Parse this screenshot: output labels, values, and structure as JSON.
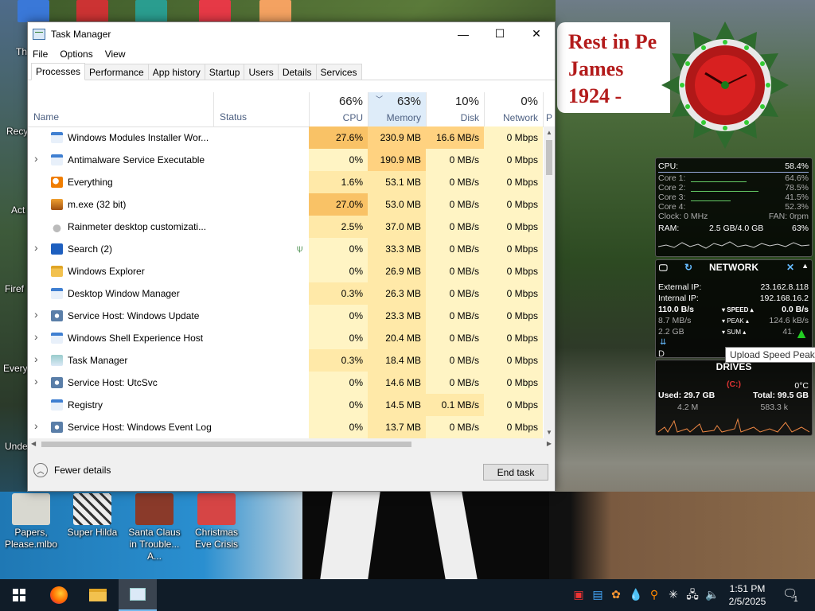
{
  "window": {
    "title": "Task Manager",
    "minimize_glyph": "—",
    "maximize_glyph": "☐",
    "close_glyph": "✕"
  },
  "menu": [
    "File",
    "Options",
    "View"
  ],
  "tabs": [
    "Processes",
    "Performance",
    "App history",
    "Startup",
    "Users",
    "Details",
    "Services"
  ],
  "active_tab": "Processes",
  "columns": {
    "name": "Name",
    "status": "Status",
    "cpu": {
      "pct": "66%",
      "label": "CPU"
    },
    "memory": {
      "pct": "63%",
      "label": "Memory"
    },
    "disk": {
      "pct": "10%",
      "label": "Disk"
    },
    "network": {
      "pct": "0%",
      "label": "Network"
    },
    "power_partial": "P"
  },
  "processes": [
    {
      "name": "Windows Modules Installer Wor...",
      "expandable": false,
      "icon": "windows-app-icon",
      "cpu": "27.6%",
      "memory": "230.9 MB",
      "disk": "16.6 MB/s",
      "network": "0 Mbps"
    },
    {
      "name": "Antimalware Service Executable",
      "expandable": true,
      "icon": "windows-app-icon",
      "cpu": "0%",
      "memory": "190.9 MB",
      "disk": "0 MB/s",
      "network": "0 Mbps"
    },
    {
      "name": "Everything",
      "expandable": false,
      "icon": "magnifier-orange-icon",
      "cpu": "1.6%",
      "memory": "53.1 MB",
      "disk": "0 MB/s",
      "network": "0 Mbps"
    },
    {
      "name": "m.exe (32 bit)",
      "expandable": false,
      "icon": "mascot-icon",
      "cpu": "27.0%",
      "memory": "53.0 MB",
      "disk": "0 MB/s",
      "network": "0 Mbps"
    },
    {
      "name": "Rainmeter desktop customizati...",
      "expandable": false,
      "icon": "rainmeter-drop-icon",
      "cpu": "2.5%",
      "memory": "37.0 MB",
      "disk": "0 MB/s",
      "network": "0 Mbps"
    },
    {
      "name": "Search (2)",
      "expandable": true,
      "icon": "search-icon",
      "cpu": "0%",
      "memory": "33.3 MB",
      "disk": "0 MB/s",
      "network": "0 Mbps",
      "suspended_leaf": true
    },
    {
      "name": "Windows Explorer",
      "expandable": false,
      "icon": "folder-icon",
      "cpu": "0%",
      "memory": "26.9 MB",
      "disk": "0 MB/s",
      "network": "0 Mbps"
    },
    {
      "name": "Desktop Window Manager",
      "expandable": false,
      "icon": "windows-app-icon",
      "cpu": "0.3%",
      "memory": "26.3 MB",
      "disk": "0 MB/s",
      "network": "0 Mbps"
    },
    {
      "name": "Service Host: Windows Update",
      "expandable": true,
      "icon": "gear-icon",
      "cpu": "0%",
      "memory": "23.3 MB",
      "disk": "0 MB/s",
      "network": "0 Mbps"
    },
    {
      "name": "Windows Shell Experience Host",
      "expandable": true,
      "icon": "windows-app-icon",
      "cpu": "0%",
      "memory": "20.4 MB",
      "disk": "0 MB/s",
      "network": "0 Mbps"
    },
    {
      "name": "Task Manager",
      "expandable": true,
      "icon": "task-manager-icon",
      "cpu": "0.3%",
      "memory": "18.4 MB",
      "disk": "0 MB/s",
      "network": "0 Mbps"
    },
    {
      "name": "Service Host: UtcSvc",
      "expandable": true,
      "icon": "gear-icon",
      "cpu": "0%",
      "memory": "14.6 MB",
      "disk": "0 MB/s",
      "network": "0 Mbps"
    },
    {
      "name": "Registry",
      "expandable": false,
      "icon": "windows-app-icon",
      "cpu": "0%",
      "memory": "14.5 MB",
      "disk": "0.1 MB/s",
      "network": "0 Mbps"
    },
    {
      "name": "Service Host: Windows Event Log",
      "expandable": true,
      "icon": "gear-icon",
      "cpu": "0%",
      "memory": "13.7 MB",
      "disk": "0 MB/s",
      "network": "0 Mbps"
    }
  ],
  "heat_colors": {
    "none": "#fff4c4",
    "light": "#ffe9a8",
    "medium": "#ffd280",
    "high": "#f9c266",
    "mem_high": "#ffd280"
  },
  "footer": {
    "fewer_details": "Fewer details",
    "end_task": "End task"
  },
  "desktop": {
    "icons": [
      {
        "label": "Papers, Please.mlbo"
      },
      {
        "label": "Super Hilda"
      },
      {
        "label": "Santa Claus in Trouble... A..."
      },
      {
        "label": "Christmas Eve Crisis"
      }
    ],
    "left_partial_labels": [
      "Th",
      "Recy",
      "Act",
      "Firef",
      "Every",
      "Unde"
    ]
  },
  "rainmeter": {
    "rip_text": [
      "Rest in Pe",
      "James",
      "1924 -"
    ],
    "system": {
      "cpu_label": "CPU:",
      "cpu_value": "58.4%",
      "cores": [
        {
          "label": "Core 1:",
          "value": "64.6%"
        },
        {
          "label": "Core 2:",
          "value": "78.5%"
        },
        {
          "label": "Core 3:",
          "value": "41.5%"
        },
        {
          "label": "Core 4:",
          "value": "52.3%"
        }
      ],
      "clock_label": "Clock: 0 MHz",
      "fan_label": "FAN: 0rpm",
      "ram_label": "RAM:",
      "ram_value": "2.5 GB/4.0 GB",
      "ram_pct": "63%"
    },
    "network": {
      "title": "NETWORK",
      "external_ip_label": "External IP:",
      "external_ip": "23.162.8.118",
      "internal_ip_label": "Internal IP:",
      "internal_ip": "192.168.16.2",
      "speed_down": "110.0 B/s",
      "speed_label": "SPEED",
      "speed_up": "0.0 B/s",
      "peak_down": "8.7 MB/s",
      "peak_label": "PEAK",
      "peak_up": "124.6 kB/s",
      "sum_down": "2.2 GB",
      "sum_label": "SUM",
      "sum_up": "41."
    },
    "drives": {
      "title": "DRIVES",
      "letter": "(C:)",
      "temp": "0°C",
      "used_label": "Used: 29.7 GB",
      "total_label": "Total: 99.5 GB",
      "read": "4.2 M",
      "write": "583.3 k"
    },
    "tooltip": "Upload Speed Peak",
    "tooltip_partial": "D"
  },
  "taskbar": {
    "time": "1:51 PM",
    "date": "2/5/2025",
    "notification_count": "1"
  }
}
